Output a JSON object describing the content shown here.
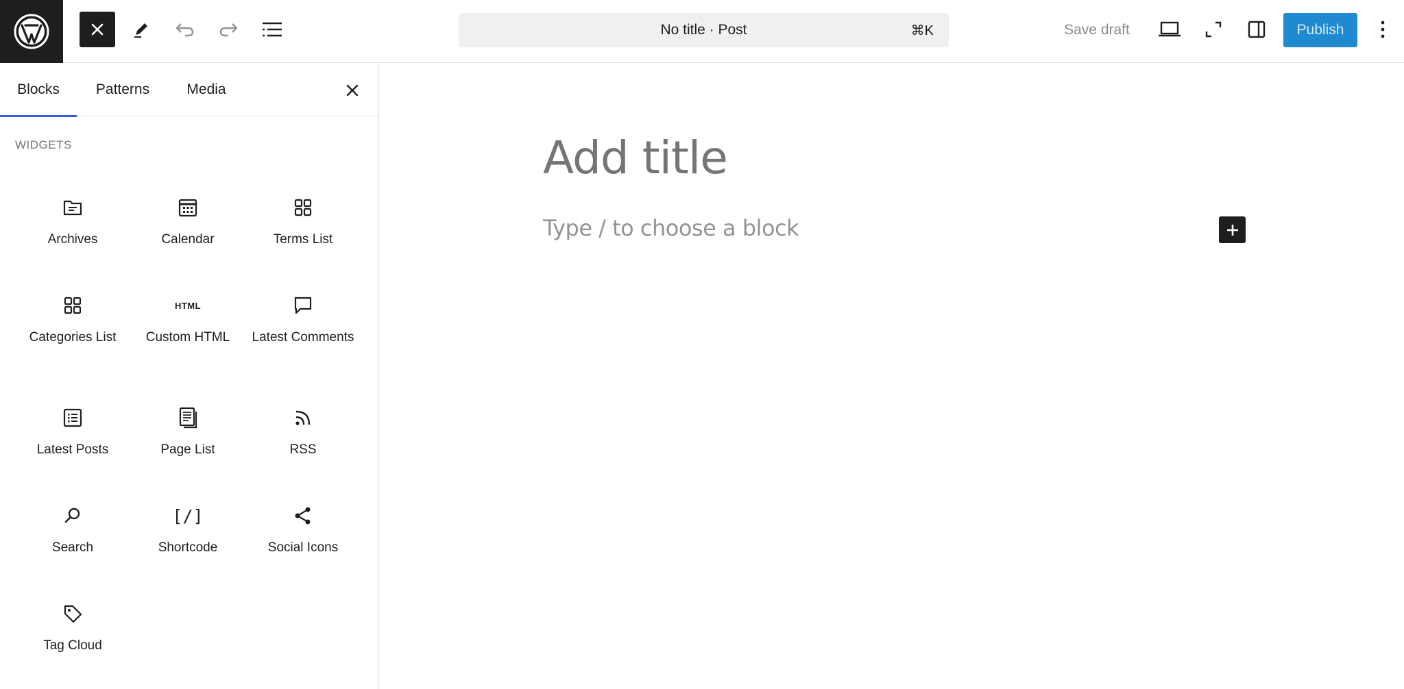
{
  "topbar": {
    "document_title": "No title · Post",
    "shortcut": "⌘K",
    "save_draft_label": "Save draft",
    "publish_label": "Publish"
  },
  "sidebar": {
    "tabs": [
      {
        "label": "Blocks",
        "active": true
      },
      {
        "label": "Patterns",
        "active": false
      },
      {
        "label": "Media",
        "active": false
      }
    ],
    "section_label": "WIDGETS",
    "blocks": [
      {
        "label": "Archives",
        "icon": "archive-folder-icon"
      },
      {
        "label": "Calendar",
        "icon": "calendar-icon"
      },
      {
        "label": "Terms List",
        "icon": "grid-icon"
      },
      {
        "label": "Categories List",
        "icon": "grid-icon"
      },
      {
        "label": "Custom HTML",
        "icon": "html-icon",
        "icon_text": "HTML"
      },
      {
        "label": "Latest Comments",
        "icon": "comment-icon"
      },
      {
        "label": "Latest Posts",
        "icon": "post-list-icon"
      },
      {
        "label": "Page List",
        "icon": "pages-icon"
      },
      {
        "label": "RSS",
        "icon": "rss-icon"
      },
      {
        "label": "Search",
        "icon": "search-icon"
      },
      {
        "label": "Shortcode",
        "icon": "shortcode-icon",
        "icon_text": "[/]"
      },
      {
        "label": "Social Icons",
        "icon": "share-icon"
      },
      {
        "label": "Tag Cloud",
        "icon": "tag-icon"
      }
    ]
  },
  "editor": {
    "title_placeholder": "Add title",
    "block_placeholder": "Type / to choose a block"
  },
  "colors": {
    "accent": "#3858e9",
    "publish": "#1f8ad0",
    "dark": "#1e1e1e"
  }
}
